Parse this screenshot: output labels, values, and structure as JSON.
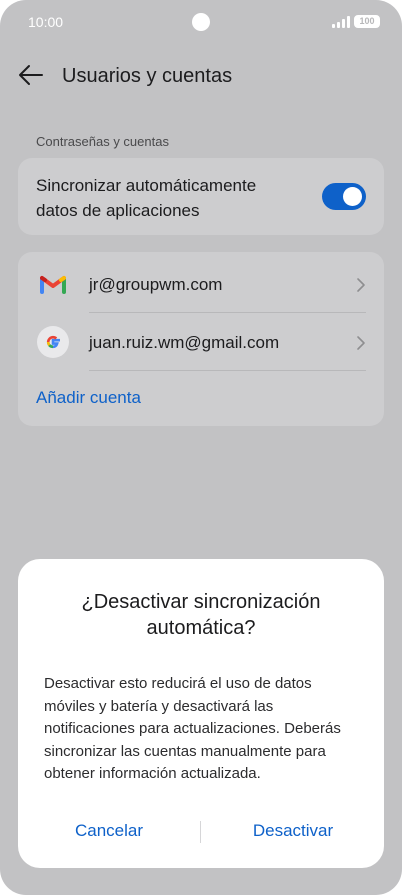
{
  "status_bar": {
    "time": "10:00",
    "battery": "100"
  },
  "header": {
    "title": "Usuarios y cuentas",
    "back_icon": "arrow-left-icon"
  },
  "section": {
    "label": "Contraseñas y cuentas"
  },
  "sync": {
    "label": "Sincronizar automáticamente datos de aplicaciones",
    "enabled": true,
    "toggle_color": "#0e61c9"
  },
  "accounts": {
    "items": [
      {
        "email": "jr@groupwm.com",
        "icon": "gmail-icon"
      },
      {
        "email": "juan.ruiz.wm@gmail.com",
        "icon": "google-icon"
      }
    ],
    "add_label": "Añadir cuenta"
  },
  "dialog": {
    "title": "¿Desactivar sincronización automática?",
    "body": "Desactivar esto reducirá el uso de datos móviles y batería y desactivará las notificaciones para actualizaciones. Deberás sincronizar las cuentas manualmente para obtener información actualizada.",
    "cancel_label": "Cancelar",
    "confirm_label": "Desactivar"
  },
  "colors": {
    "accent": "#0e61c9",
    "overlay_bg": "#c2c2c4"
  }
}
